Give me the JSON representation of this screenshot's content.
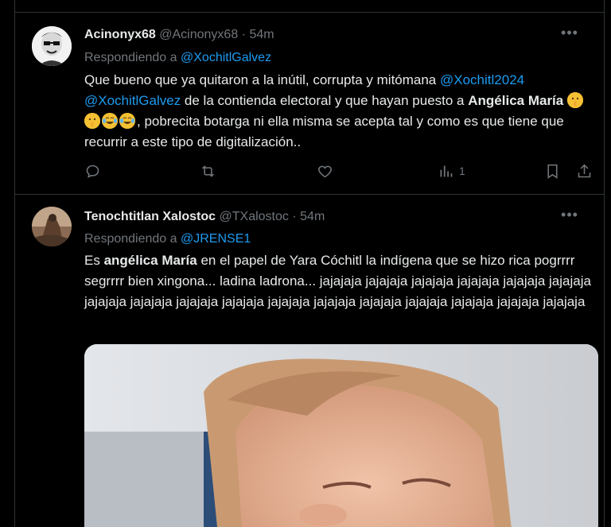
{
  "tweets": [
    {
      "display_name": "Acinonyx68",
      "handle": "@Acinonyx68",
      "separator": "·",
      "time": "54m",
      "more_icon": "ellipsis-icon",
      "replying_prefix": "Respondiendo a",
      "replying_to": "@XochitlGalvez",
      "text": {
        "part1": "Que bueno que ya quitaron a la inútil, corrupta y mitómana ",
        "mention1": "@Xochitl2024",
        "mention2": "@XochitlGalvez",
        "part2": " de la contienda electoral y que hayan puesto a ",
        "bold": "Angélica María",
        "part3": ", pobrecita botarga ni ella misma se acepta tal y como es que tiene que recurrir a este tipo de digitalización.."
      },
      "emojis": [
        "shushing-face-icon",
        "shushing-face-icon",
        "joy-face-icon",
        "joy-face-icon"
      ],
      "actions": {
        "reply_icon": "reply-icon",
        "retweet_icon": "retweet-icon",
        "like_icon": "heart-icon",
        "views_icon": "views-icon",
        "views_count": "1",
        "bookmark_icon": "bookmark-icon",
        "share_icon": "share-icon"
      }
    },
    {
      "display_name": "Tenochtitlan Xalostoc",
      "handle": "@TXalostoc",
      "separator": "·",
      "time": "54m",
      "more_icon": "ellipsis-icon",
      "replying_prefix": "Respondiendo a",
      "replying_to": "@JRENSE1",
      "text": {
        "part1": "Es ",
        "bold": "angélica María",
        "part2": " en el papel de Yara Cóchitl la indígena que se hizo rica pogrrrr segrrrr bien xingona... ladina ladrona... jajajaja jajajaja jajajaja jajajaja jajajaja jajajaja jajajaja jajajaja jajajaja jajajaja jajajaja jajajaja jajajaja jajajaja jajajaja jajajaja jajajaja"
      },
      "media": "photo-icon"
    }
  ],
  "colors": {
    "background": "#000000",
    "text": "#e7e9ea",
    "muted": "#71767b",
    "accent": "#1d9bf0",
    "border": "#2f3336"
  }
}
